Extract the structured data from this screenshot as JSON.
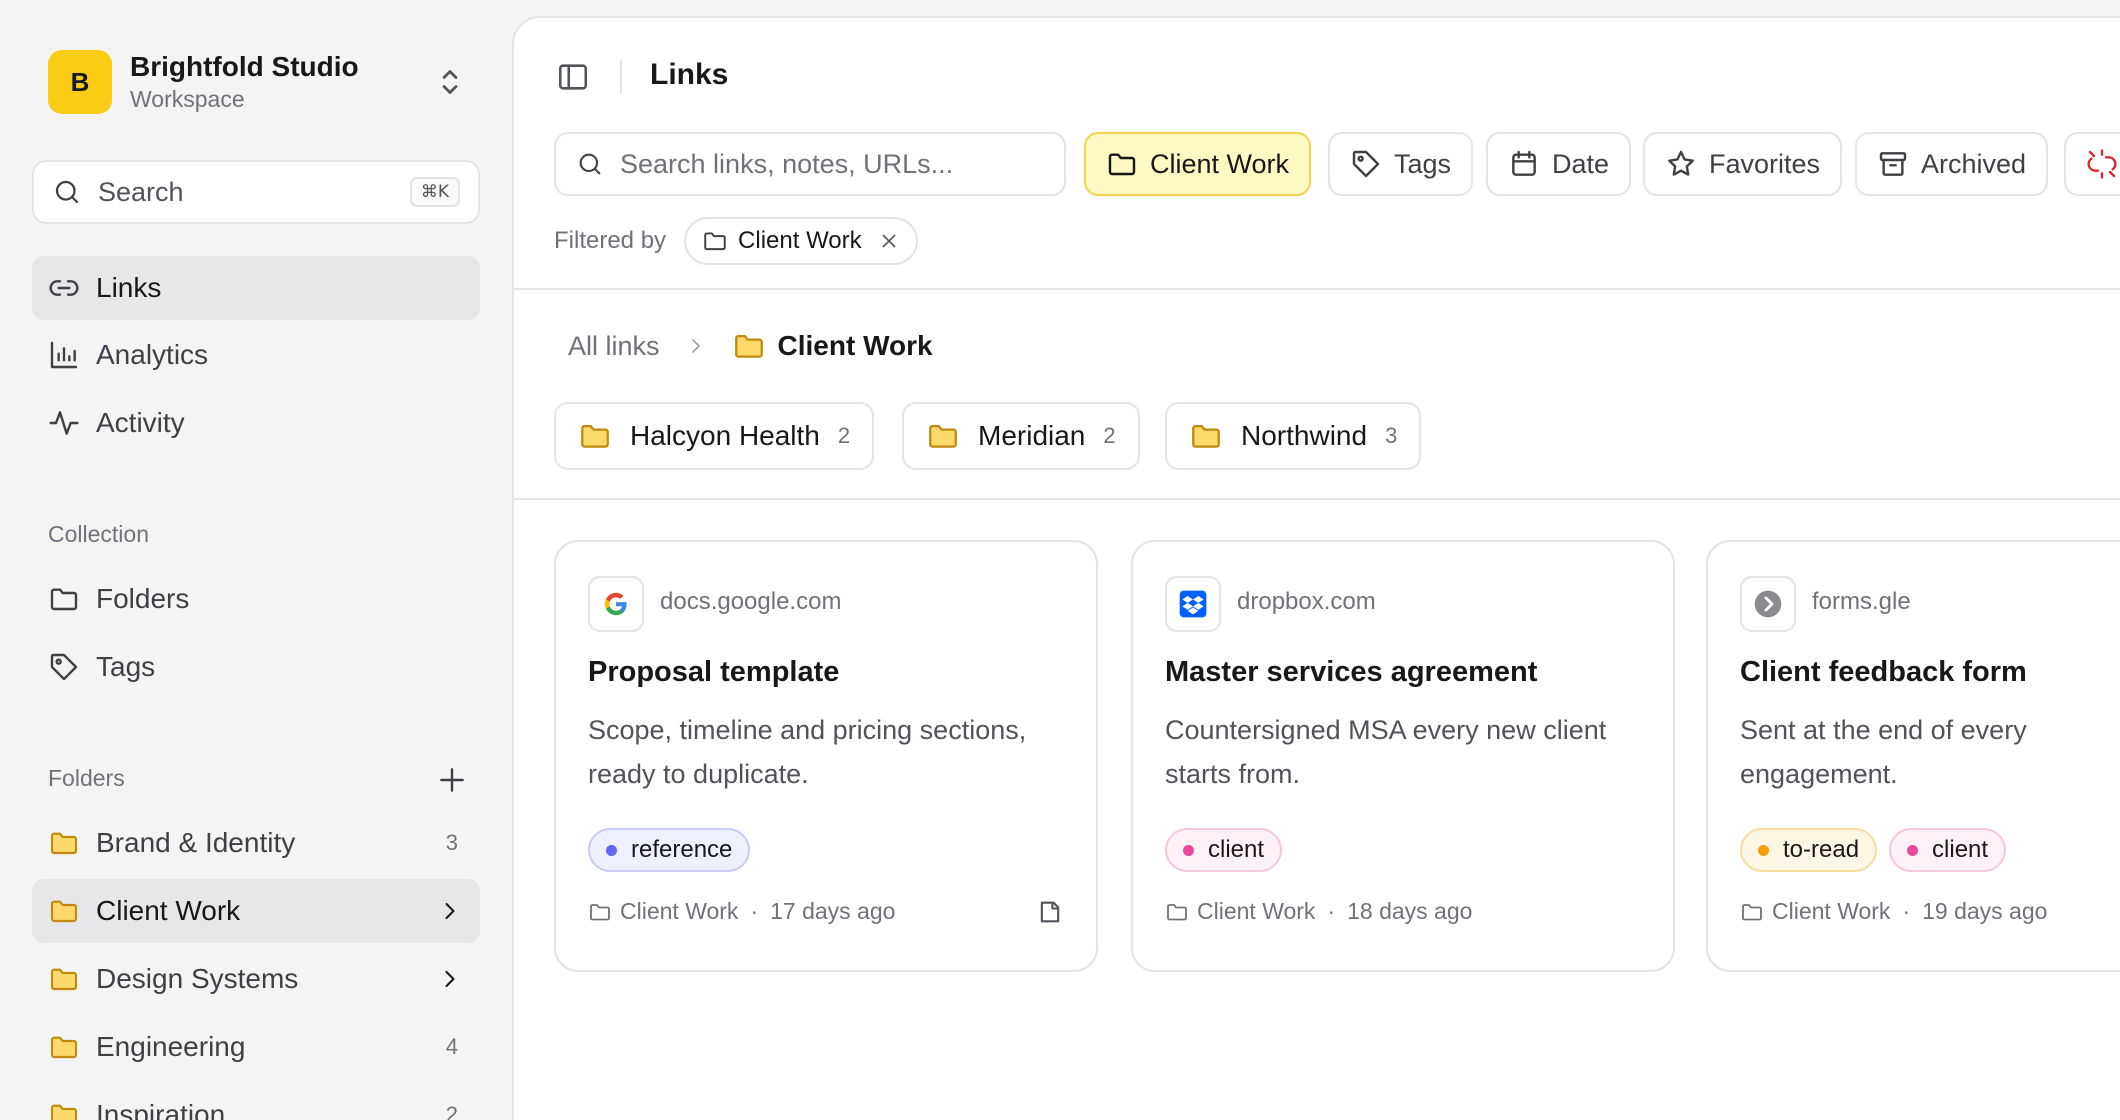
{
  "workspace": {
    "initial": "B",
    "name": "Brightfold Studio",
    "subtitle": "Workspace"
  },
  "sidebar": {
    "search_label": "Search",
    "search_shortcut": "⌘K",
    "nav": [
      {
        "label": "Links",
        "icon": "link-icon",
        "active": true
      },
      {
        "label": "Analytics",
        "icon": "bar-chart-icon"
      },
      {
        "label": "Activity",
        "icon": "activity-icon"
      }
    ],
    "collection_title": "Collection",
    "collection": [
      {
        "label": "Folders",
        "icon": "folder-icon"
      },
      {
        "label": "Tags",
        "icon": "tag-icon"
      }
    ],
    "folders_title": "Folders",
    "folders": [
      {
        "label": "Brand & Identity",
        "count": "3"
      },
      {
        "label": "Client Work",
        "active": true,
        "expandable": true
      },
      {
        "label": "Design Systems",
        "expandable": true
      },
      {
        "label": "Engineering",
        "count": "4"
      },
      {
        "label": "Inspiration",
        "count": "2"
      }
    ]
  },
  "header": {
    "title": "Links"
  },
  "toolbar": {
    "search_placeholder": "Search links, notes, URLs...",
    "chips": [
      {
        "label": "Client Work",
        "icon": "folder-icon",
        "selected": true
      },
      {
        "label": "Tags",
        "icon": "tag-icon"
      },
      {
        "label": "Date",
        "icon": "calendar-icon"
      },
      {
        "label": "Favorites",
        "icon": "star-icon"
      },
      {
        "label": "Archived",
        "icon": "archive-icon"
      }
    ],
    "filtered_by_label": "Filtered by",
    "active_filter": "Client Work"
  },
  "breadcrumb": {
    "root": "All links",
    "current": "Client Work"
  },
  "subfolders": [
    {
      "name": "Halcyon Health",
      "count": "2"
    },
    {
      "name": "Meridian",
      "count": "2"
    },
    {
      "name": "Northwind",
      "count": "3"
    }
  ],
  "cards": [
    {
      "domain": "docs.google.com",
      "favicon": "google-icon",
      "title": "Proposal template",
      "desc": "Scope, timeline and pricing sections, ready to duplicate.",
      "tags": [
        {
          "label": "reference",
          "dot": "#6366f1",
          "bg": "#eef0fd",
          "border": "#c7cbf5"
        }
      ],
      "folder": "Client Work",
      "age": "17 days ago",
      "has_note": true
    },
    {
      "domain": "dropbox.com",
      "favicon": "dropbox-icon",
      "title": "Master services agreement",
      "desc": "Countersigned MSA every new client starts from.",
      "tags": [
        {
          "label": "client",
          "dot": "#ec4899",
          "bg": "#fdf0f6",
          "border": "#f6c6dc"
        }
      ],
      "folder": "Client Work",
      "age": "18 days ago"
    },
    {
      "domain": "forms.gle",
      "favicon": "forms-icon",
      "title": "Client feedback form",
      "desc": "Sent at the end of every engagement.",
      "tags": [
        {
          "label": "to-read",
          "dot": "#f59e0b",
          "bg": "#fef6e4",
          "border": "#f6dc9e"
        },
        {
          "label": "client",
          "dot": "#ec4899",
          "bg": "#fdf0f6",
          "border": "#f6c6dc"
        }
      ],
      "folder": "Client Work",
      "age": "19 days ago"
    }
  ],
  "colors": {
    "accent": "#facc15",
    "folder": "#fbd96a",
    "folder_stroke": "#c08a0c",
    "background": "#f4f4f5"
  }
}
